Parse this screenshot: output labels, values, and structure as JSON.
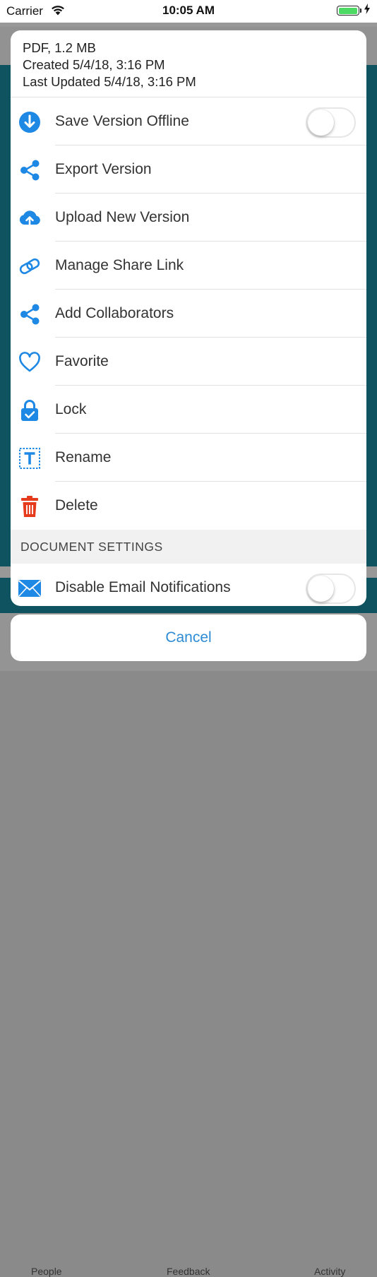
{
  "status_bar": {
    "carrier": "Carrier",
    "time": "10:05 AM",
    "battery_percent": 100
  },
  "background": {
    "tabs": [
      "People",
      "Feedback",
      "Activity"
    ]
  },
  "sheet": {
    "meta": {
      "type_size": "PDF, 1.2 MB",
      "created": "Created 5/4/18, 3:16 PM",
      "updated": "Last Updated 5/4/18, 3:16 PM"
    },
    "menu": [
      {
        "label": "Save Version Offline",
        "icon": "download-circle-icon",
        "toggle": false
      },
      {
        "label": "Export Version",
        "icon": "share-icon"
      },
      {
        "label": "Upload New Version",
        "icon": "cloud-upload-icon"
      },
      {
        "label": "Manage Share Link",
        "icon": "link-icon"
      },
      {
        "label": "Add Collaborators",
        "icon": "share-icon"
      },
      {
        "label": "Favorite",
        "icon": "heart-icon"
      },
      {
        "label": "Lock",
        "icon": "lock-check-icon"
      },
      {
        "label": "Rename",
        "icon": "rename-icon"
      },
      {
        "label": "Delete",
        "icon": "trash-icon"
      }
    ],
    "document_settings": {
      "header": "DOCUMENT SETTINGS",
      "items": [
        {
          "label": "Disable Email Notifications",
          "icon": "mail-icon",
          "toggle": false
        }
      ]
    }
  },
  "cancel_label": "Cancel",
  "colors": {
    "accent": "#2d8bd6",
    "icon_blue": "#1e88e5",
    "delete_red": "#e53a1c",
    "battery_green": "#4cd964"
  }
}
